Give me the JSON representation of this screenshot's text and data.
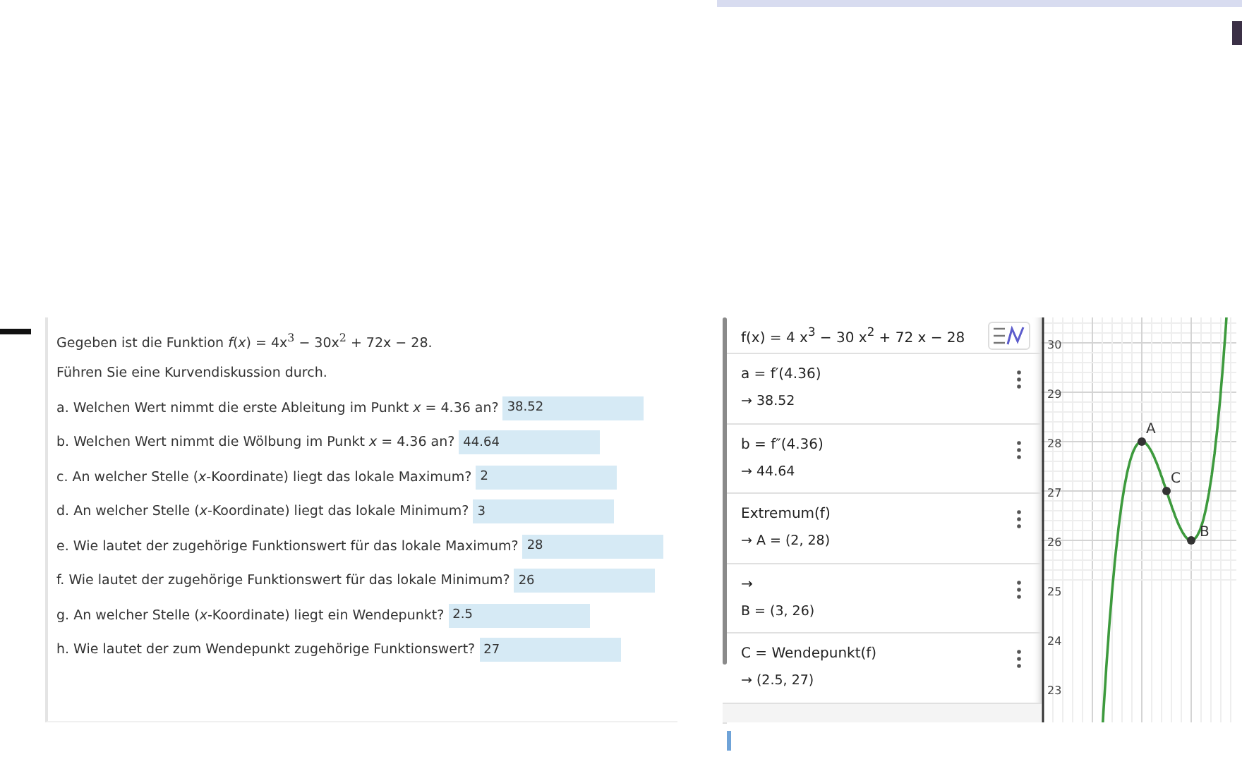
{
  "task": {
    "intro": "Gegeben ist die Funktion *f*(*x*) = 4x$^{3}$ − 30x$^{2}$ + 72x − 28.",
    "instruction": "Führen Sie eine Kurvendiskussion durch.",
    "questions": [
      {
        "text": "a. Welchen Wert nimmt die erste Ableitung im Punkt *x* = 4.36 an?",
        "value": "38.52"
      },
      {
        "text": "b. Welchen Wert nimmt die Wölbung im Punkt *x* = 4.36 an?",
        "value": "44.64"
      },
      {
        "text": "c. An welcher Stelle (*x*-Koordinate) liegt das lokale Maximum?",
        "value": "2"
      },
      {
        "text": "d. An welcher Stelle (*x*-Koordinate) liegt das lokale Minimum?",
        "value": "3"
      },
      {
        "text": "e. Wie lautet der zugehörige Funktionswert für das lokale Maximum?",
        "value": "28"
      },
      {
        "text": "f. Wie lautet der zugehörige Funktionswert für das lokale Minimum?",
        "value": "26"
      },
      {
        "text": "g. An welcher Stelle (*x*-Koordinate) liegt ein Wendepunkt?",
        "value": "2.5"
      },
      {
        "text": "h. Wie lautet der zum Wendepunkt zugehörige Funktionswert?",
        "value": "27"
      }
    ]
  },
  "algebra": {
    "function": "f(x) = 4 x$^{3}$ − 30 x$^{2}$ + 72 x − 28",
    "entries": [
      {
        "lines": [
          "a = f′(4.36)",
          "→ 38.52"
        ]
      },
      {
        "lines": [
          "b = f″(4.36)",
          "→ 44.64"
        ]
      },
      {
        "lines": [
          "Extremum(f)",
          "→ A = (2, 28)"
        ]
      },
      {
        "lines": [
          "→",
          "B = (3, 26)"
        ]
      },
      {
        "lines": [
          "C = Wendepunkt(f)",
          "→ (2.5, 27)"
        ]
      }
    ]
  },
  "graph": {
    "y_tick_labels": [
      "30",
      "29",
      "28",
      "27",
      "26",
      "25",
      "24",
      "23"
    ],
    "points": [
      {
        "label": "A"
      },
      {
        "label": "C"
      },
      {
        "label": "B"
      }
    ]
  }
}
